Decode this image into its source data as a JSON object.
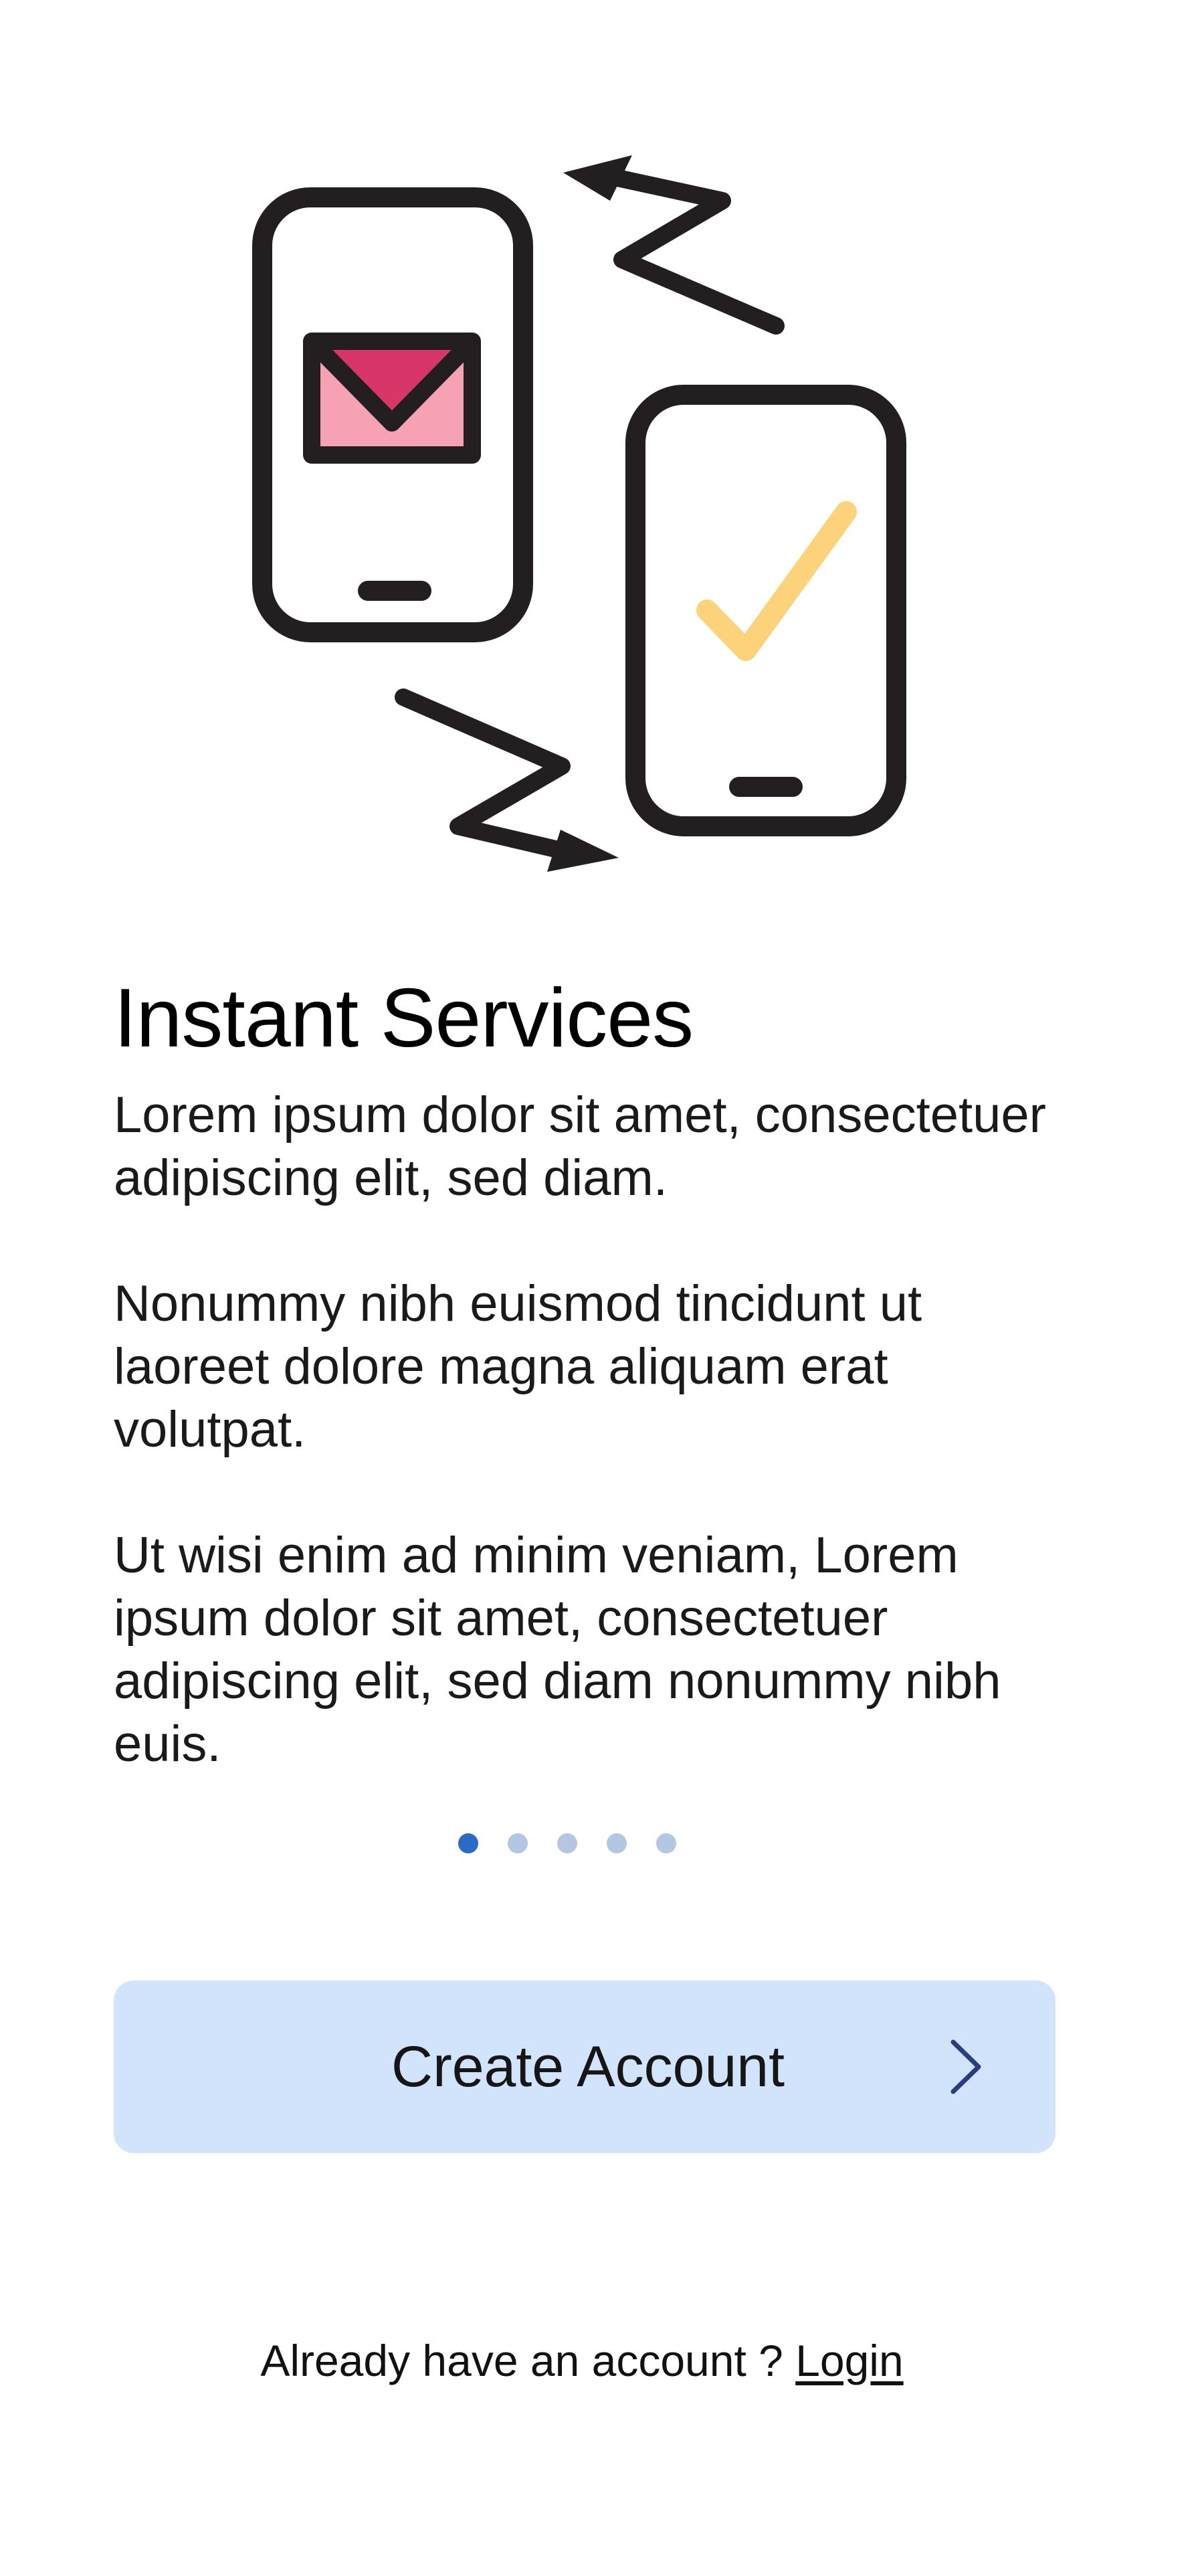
{
  "onboarding": {
    "title": "Instant Services",
    "paragraphs": [
      "Lorem ipsum dolor sit amet, consectetuer adipiscing elit, sed diam.",
      "Nonummy nibh euismod tincidunt ut laoreet dolore magna aliquam erat volutpat.",
      "Ut wisi enim ad minim veniam, Lorem ipsum dolor sit amet, consectetuer adipiscing elit, sed diam nonummy nibh euis."
    ],
    "pagination": {
      "total": 5,
      "current": 1
    }
  },
  "cta": {
    "label": "Create Account",
    "icon": "chevron-right-icon"
  },
  "footer": {
    "prompt": "Already have an account ? ",
    "login_label": "Login"
  },
  "illustration": {
    "icons": [
      "phone-icon",
      "mail-icon",
      "check-icon",
      "signal-bolt-icon"
    ]
  },
  "colors": {
    "background": "#ffffff",
    "button_bg": "#d2e4fb",
    "dot_active": "#2b6bc7",
    "dot_inactive": "#b3c7e2",
    "chevron": "#2a3d7c",
    "outline": "#231f20",
    "mail_fill": "#f7a1b4",
    "mail_flap": "#d83568",
    "check": "#fcd27a"
  }
}
